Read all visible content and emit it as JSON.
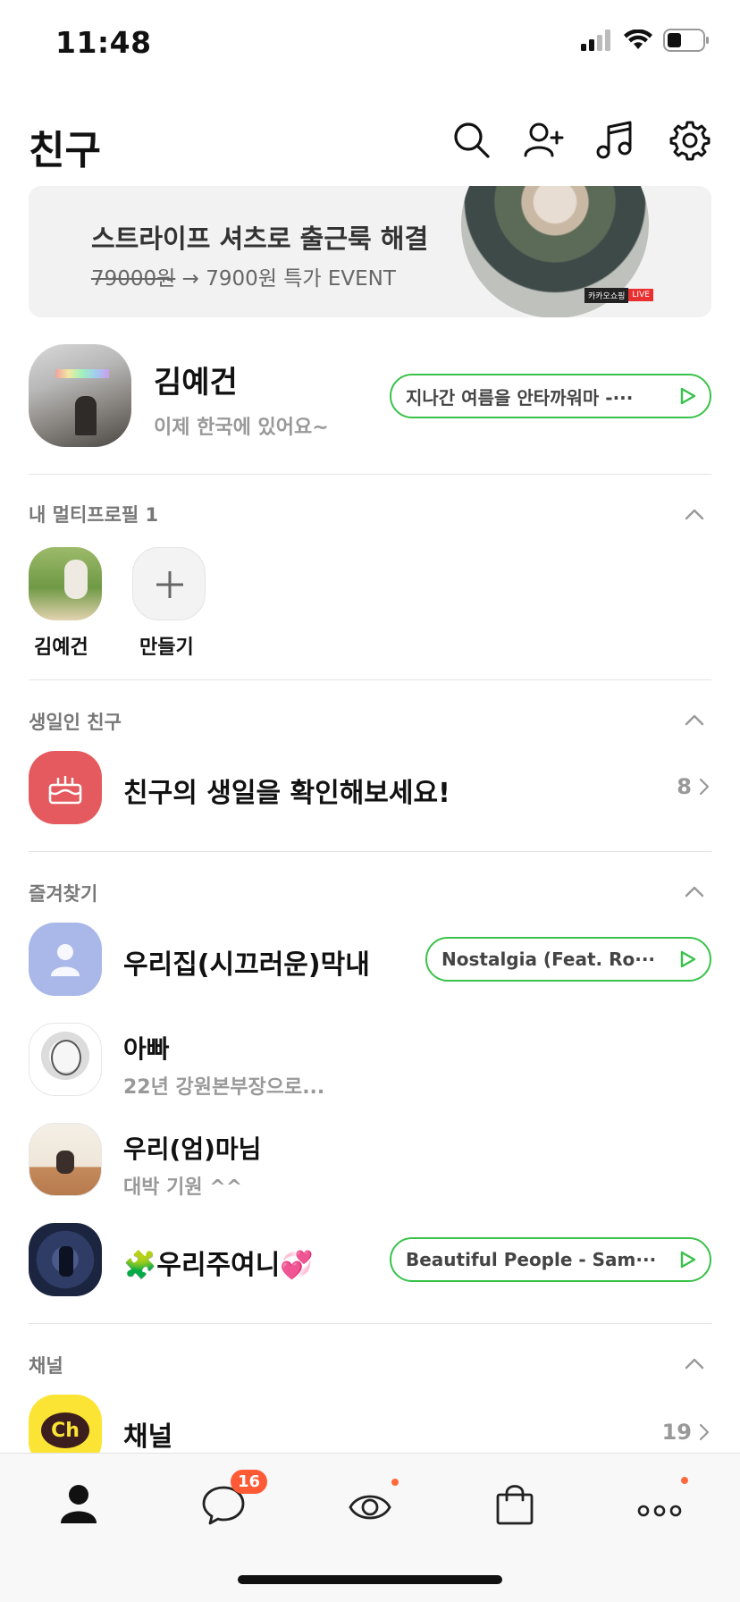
{
  "status_bar": {
    "time": "11:48"
  },
  "header": {
    "title": "친구"
  },
  "banner": {
    "title": "스트라이프 셔츠로 출근룩 해결",
    "price_old": "79000원",
    "price_rest": " → 7900원 특가 EVENT",
    "badge_brand": "카카오쇼핑",
    "badge_live": "LIVE"
  },
  "my_profile": {
    "name": "김예건",
    "status": "이제 한국에 있어요~",
    "music": "지나간 여름을 안타까워마 -···"
  },
  "multi_profile": {
    "label": "내 멀티프로필 1",
    "items": [
      {
        "label": "김예건"
      },
      {
        "label": "만들기"
      }
    ]
  },
  "birthday": {
    "label": "생일인 친구",
    "text": "친구의 생일을 확인해보세요!",
    "count": "8"
  },
  "favorites": {
    "label": "즐겨찾기",
    "items": [
      {
        "name": "우리집(시끄러운)막내",
        "status": "",
        "music": "Nostalgia (Feat. Ro···"
      },
      {
        "name": "아빠",
        "status": "22년 강원본부장으로...",
        "music": ""
      },
      {
        "name": "우리(엄)마님",
        "status": "대박 기원 ^^",
        "music": ""
      },
      {
        "name": "🧩우리주여니💞",
        "status": "",
        "music": "Beautiful People - Sam···"
      }
    ]
  },
  "channel": {
    "label": "채널",
    "name": "채널",
    "logo": "Ch",
    "count": "19"
  },
  "tabbar": {
    "chat_badge": "16"
  },
  "colors": {
    "accent_green": "#39c24a",
    "badge_orange": "#ff5a36",
    "birthday_red": "#e45a5e",
    "channel_yellow": "#fbe433"
  }
}
